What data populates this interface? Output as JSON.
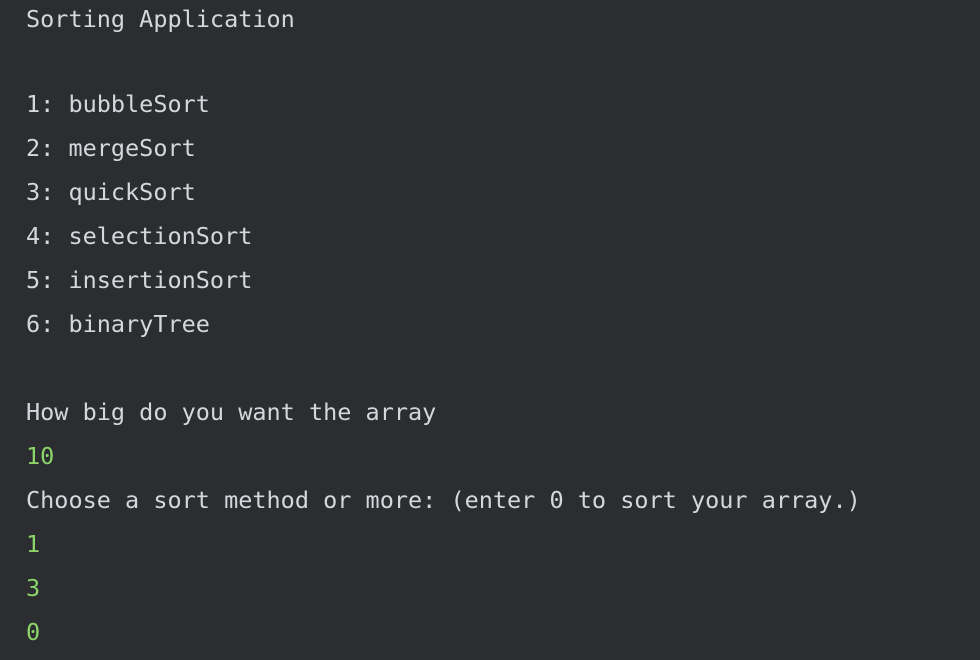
{
  "console": {
    "title": "Sorting Application",
    "menu": [
      "1: bubbleSort",
      "2: mergeSort",
      "3: quickSort",
      "4: selectionSort",
      "5: insertionSort",
      "6: binaryTree"
    ],
    "size_prompt": "How big do you want the array",
    "size_input": "10",
    "method_prompt": "Choose a sort method or more: (enter 0 to sort your array.)",
    "method_inputs": [
      "1",
      "3",
      "0"
    ]
  },
  "colors": {
    "background": "#2b2d30",
    "output_text": "#d4d7dc",
    "user_input_text": "#8cd46a"
  }
}
